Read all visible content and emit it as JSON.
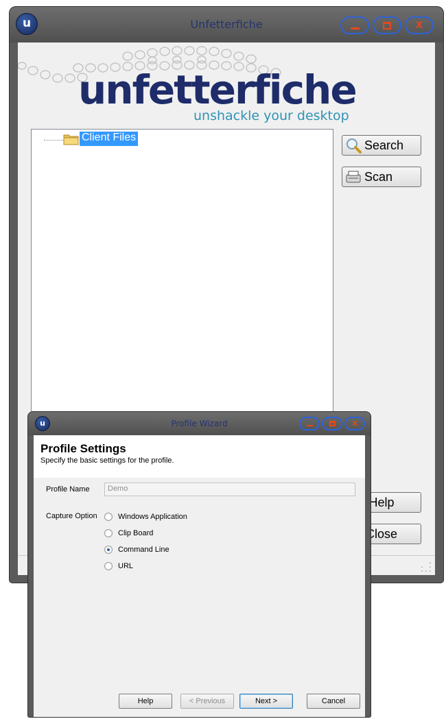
{
  "main_window": {
    "title": "Unfetterfiche",
    "app_badge": "u",
    "logo": {
      "word": "unfetterfiche",
      "tagline": "unshackle your desktop"
    },
    "tree": {
      "root_label": "Client Files",
      "root_icon": "folder-icon"
    },
    "buttons": {
      "search": "Search",
      "scan": "Scan",
      "help": "Help",
      "close": "Close"
    },
    "caption_icons": [
      "minimize-icon",
      "maximize-icon",
      "close-icon"
    ]
  },
  "wizard": {
    "title": "Profile Wizard",
    "app_badge": "u",
    "header": {
      "title": "Profile Settings",
      "subtitle": "Specify the basic settings for the profile."
    },
    "profile_name": {
      "label": "Profile Name",
      "value": "Demo"
    },
    "capture_option": {
      "label": "Capture Option",
      "options": [
        {
          "label": "Windows Application",
          "checked": false
        },
        {
          "label": "Clip Board",
          "checked": false
        },
        {
          "label": "Command Line",
          "checked": true
        },
        {
          "label": "URL",
          "checked": false
        }
      ]
    },
    "buttons": {
      "help": "Help",
      "previous": "< Previous",
      "next": "Next >",
      "cancel": "Cancel"
    }
  },
  "colors": {
    "frame": "#5b5b5b",
    "title_text": "#26346f",
    "caption_outline": "#2d62d8",
    "caption_glyph": "#e24a20",
    "selection": "#3399ff",
    "logo_word": "#1e2c6a",
    "logo_tagline": "#2f92b4"
  }
}
